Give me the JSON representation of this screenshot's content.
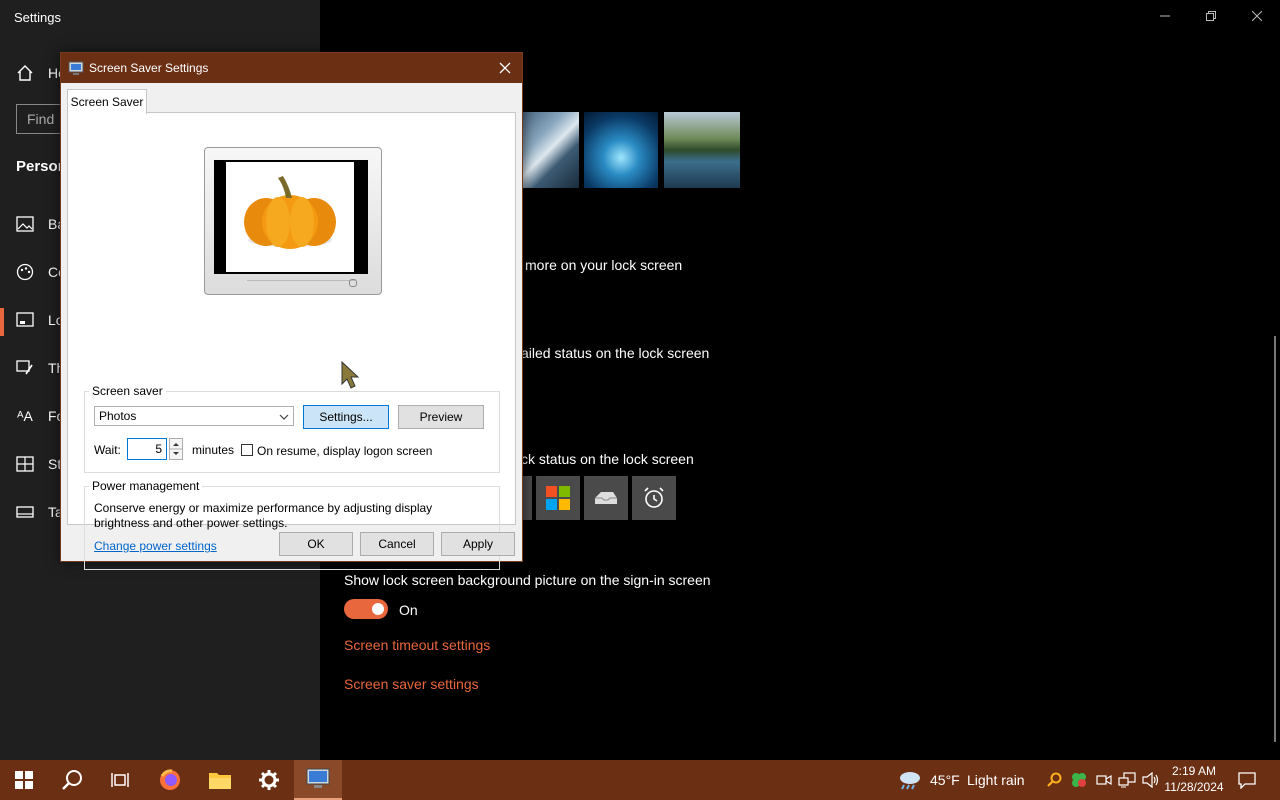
{
  "settings": {
    "window_title": "Settings",
    "sidebar": {
      "home_label": "Ho",
      "search_placeholder": "Find",
      "section_title": "Person",
      "items": [
        {
          "label": "Ba",
          "icon": "picture-icon"
        },
        {
          "label": "Co",
          "icon": "palette-icon"
        },
        {
          "label": "Lo",
          "icon": "lock-screen-icon"
        },
        {
          "label": "Th",
          "icon": "brush-icon"
        },
        {
          "label": "Fo",
          "icon": "font-icon"
        },
        {
          "label": "St",
          "icon": "start-icon"
        },
        {
          "label": "Ta",
          "icon": "taskbar-icon"
        }
      ]
    },
    "main": {
      "line1": "more on your lock screen",
      "line2": "ailed status on the lock screen",
      "line3": "ck status on the lock screen",
      "signin_label": "Show lock screen background picture on the sign-in screen",
      "toggle_state": "On",
      "timeout_link": "Screen timeout settings",
      "saver_link": "Screen saver settings"
    }
  },
  "dialog": {
    "title": "Screen Saver Settings",
    "tab": "Screen Saver",
    "screen_saver": {
      "group_label": "Screen saver",
      "selected": "Photos",
      "settings_button": "Settings...",
      "preview_button": "Preview",
      "wait_label": "Wait:",
      "wait_value": "5",
      "minutes_label": "minutes",
      "resume_label": "On resume, display logon screen",
      "resume_checked": false
    },
    "power": {
      "group_label": "Power management",
      "description": "Conserve energy or maximize performance by adjusting display brightness and other power settings.",
      "link": "Change power settings"
    },
    "ok": "OK",
    "cancel": "Cancel",
    "apply": "Apply"
  },
  "taskbar": {
    "weather_temp": "45°F",
    "weather_desc": "Light rain",
    "time": "2:19 AM",
    "date": "11/28/2024"
  },
  "colors": {
    "accent": "#e8673c",
    "taskbar": "#6b2f14",
    "link_blue": "#0066cc"
  }
}
